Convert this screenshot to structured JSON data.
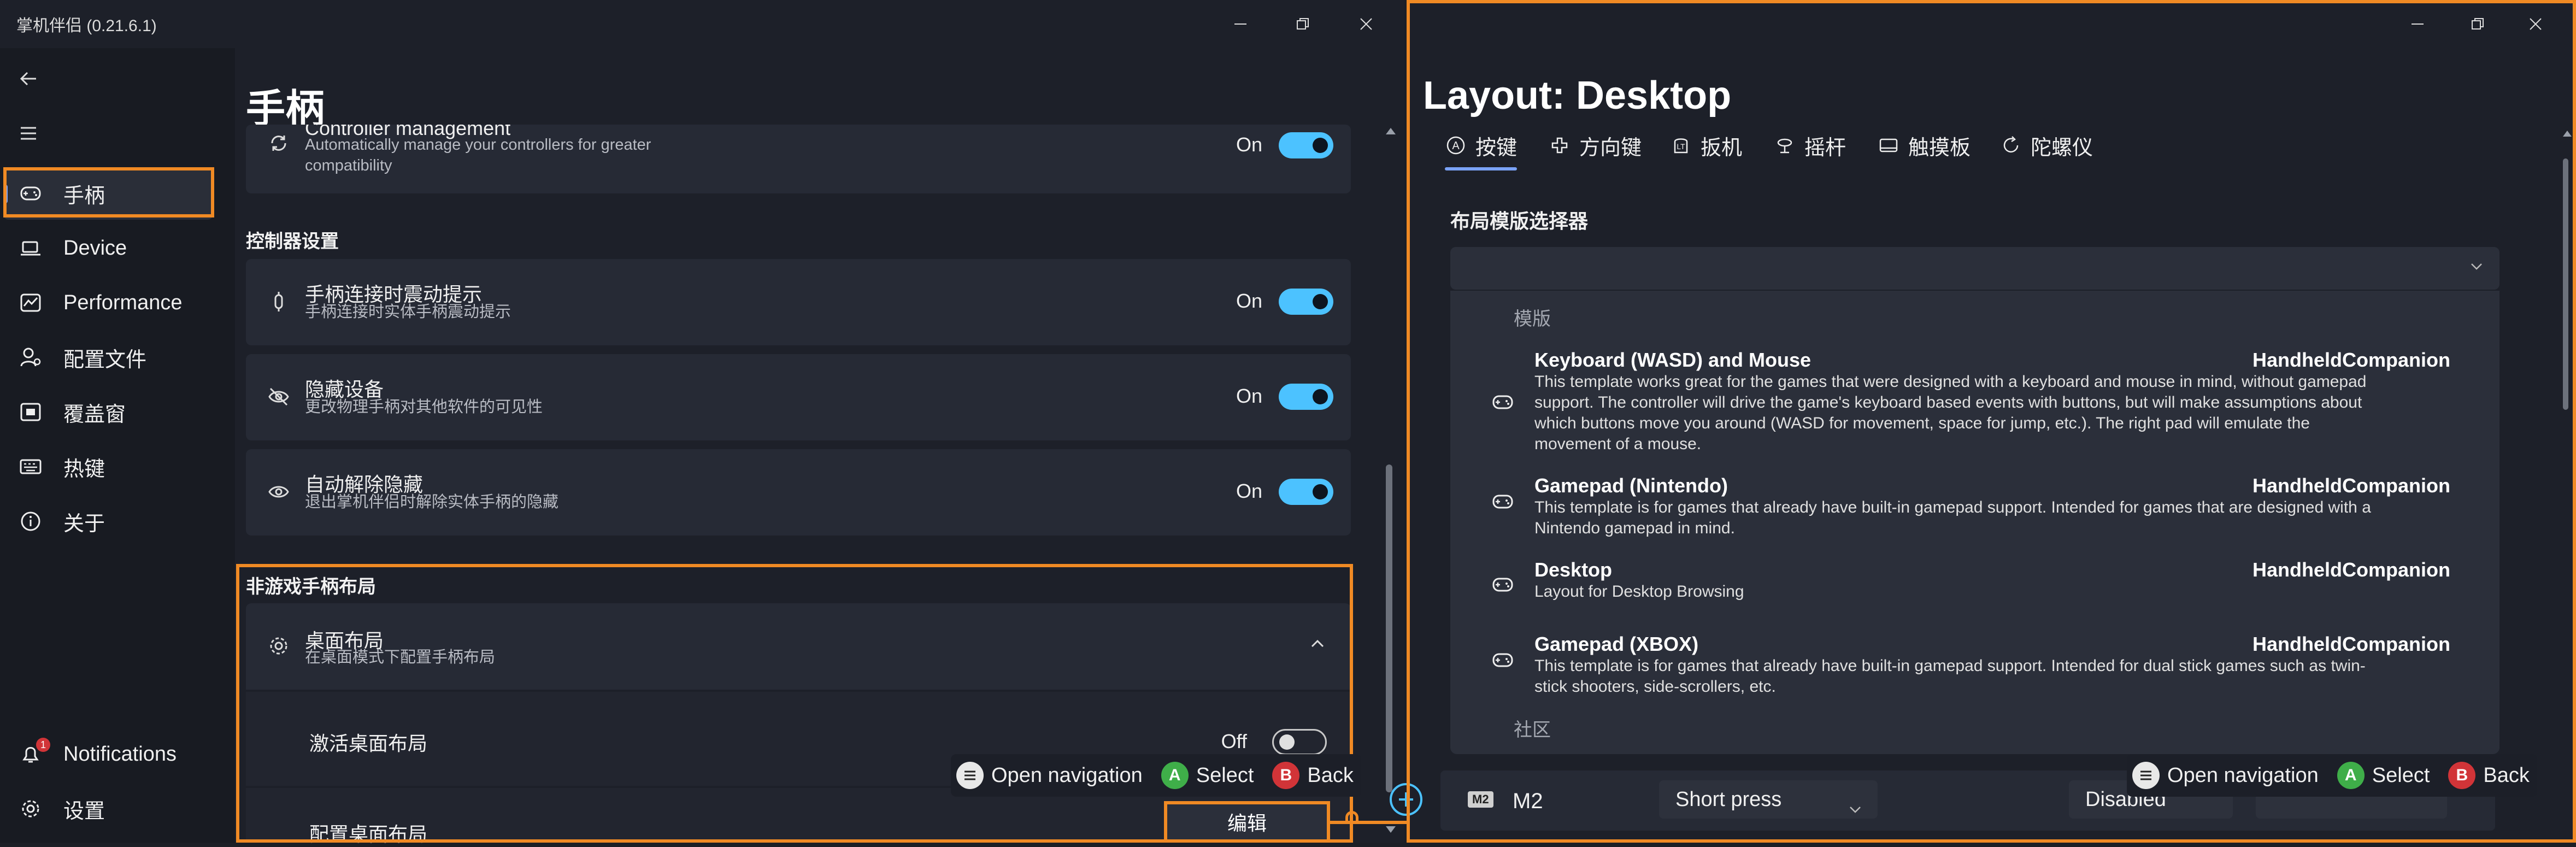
{
  "left_window": {
    "title": "掌机伴侣 (0.21.6.1)",
    "sidebar": {
      "items": [
        {
          "label": "手柄",
          "icon": "gamepad-icon",
          "active": true
        },
        {
          "label": "Device",
          "icon": "laptop-icon"
        },
        {
          "label": "Performance",
          "icon": "performance-icon"
        },
        {
          "label": "配置文件",
          "icon": "profiles-icon"
        },
        {
          "label": "覆盖窗",
          "icon": "overlay-icon"
        },
        {
          "label": "热键",
          "icon": "keyboard-icon"
        },
        {
          "label": "关于",
          "icon": "info-icon"
        }
      ],
      "notifications": {
        "label": "Notifications",
        "badge": "1"
      },
      "settings": {
        "label": "设置"
      }
    },
    "page_title": "手柄",
    "controller_management": {
      "title": "Controller management",
      "desc_line1": "Automatically manage your controllers for greater",
      "desc_line2": "compatibility",
      "state": "On"
    },
    "section_controller_settings": "控制器设置",
    "settings_cards": [
      {
        "title": "手柄连接时震动提示",
        "desc": "手柄连接时实体手柄震动提示",
        "state": "On"
      },
      {
        "title": "隐藏设备",
        "desc": "更改物理手柄对其他软件的可见性",
        "state": "On"
      },
      {
        "title": "自动解除隐藏",
        "desc": "退出掌机伴侣时解除实体手柄的隐藏",
        "state": "On"
      }
    ],
    "section_non_game_layout": "非游戏手柄布局",
    "desktop_layout": {
      "title": "桌面布局",
      "desc": "在桌面模式下配置手柄布局",
      "activate_label": "激活桌面布局",
      "activate_state": "Off",
      "configure_label": "配置桌面布局",
      "edit_button": "编辑"
    },
    "hints": {
      "open_navigation": "Open navigation",
      "select": "Select",
      "back": "Back",
      "a": "A",
      "b": "B"
    }
  },
  "right_window": {
    "title": "Layout: Desktop",
    "tabs": [
      "按键",
      "方向键",
      "扳机",
      "摇杆",
      "触摸板",
      "陀螺仪"
    ],
    "selector_label": "布局模版选择器",
    "group_templates": "模版",
    "group_community": "社区",
    "templates": [
      {
        "name": "Keyboard (WASD) and Mouse",
        "owner": "HandheldCompanion",
        "desc": [
          "This template works great for the games that were designed with a keyboard and mouse in mind, without gamepad",
          "support. The controller will drive the game's keyboard based events with buttons, but will make assumptions about",
          "which buttons move you around (WASD for movement, space for jump, etc.). The right pad will emulate the",
          "movement of a mouse."
        ]
      },
      {
        "name": "Gamepad (Nintendo)",
        "owner": "HandheldCompanion",
        "desc": [
          "This template is for games that already have built-in gamepad support. Intended for games that are designed with a",
          "Nintendo gamepad in mind."
        ]
      },
      {
        "name": "Desktop",
        "owner": "HandheldCompanion",
        "desc": [
          "Layout for Desktop Browsing"
        ]
      },
      {
        "name": "Gamepad (XBOX)",
        "owner": "HandheldCompanion",
        "desc": [
          "This template is for games that already have built-in gamepad support. Intended for dual stick games such as twin-",
          "stick shooters, side-scrollers, etc."
        ]
      }
    ],
    "bottom_row": {
      "badge": "M2",
      "button": "M2",
      "press_type": "Short press",
      "action": "Disabled"
    },
    "hints": {
      "open_navigation": "Open navigation",
      "select": "Select",
      "back": "Back",
      "a": "A",
      "b": "B"
    }
  },
  "colors": {
    "accent": "#4cc2ff",
    "highlight": "#f08a24",
    "hint_a": "#3fae49",
    "hint_b": "#d13438"
  }
}
